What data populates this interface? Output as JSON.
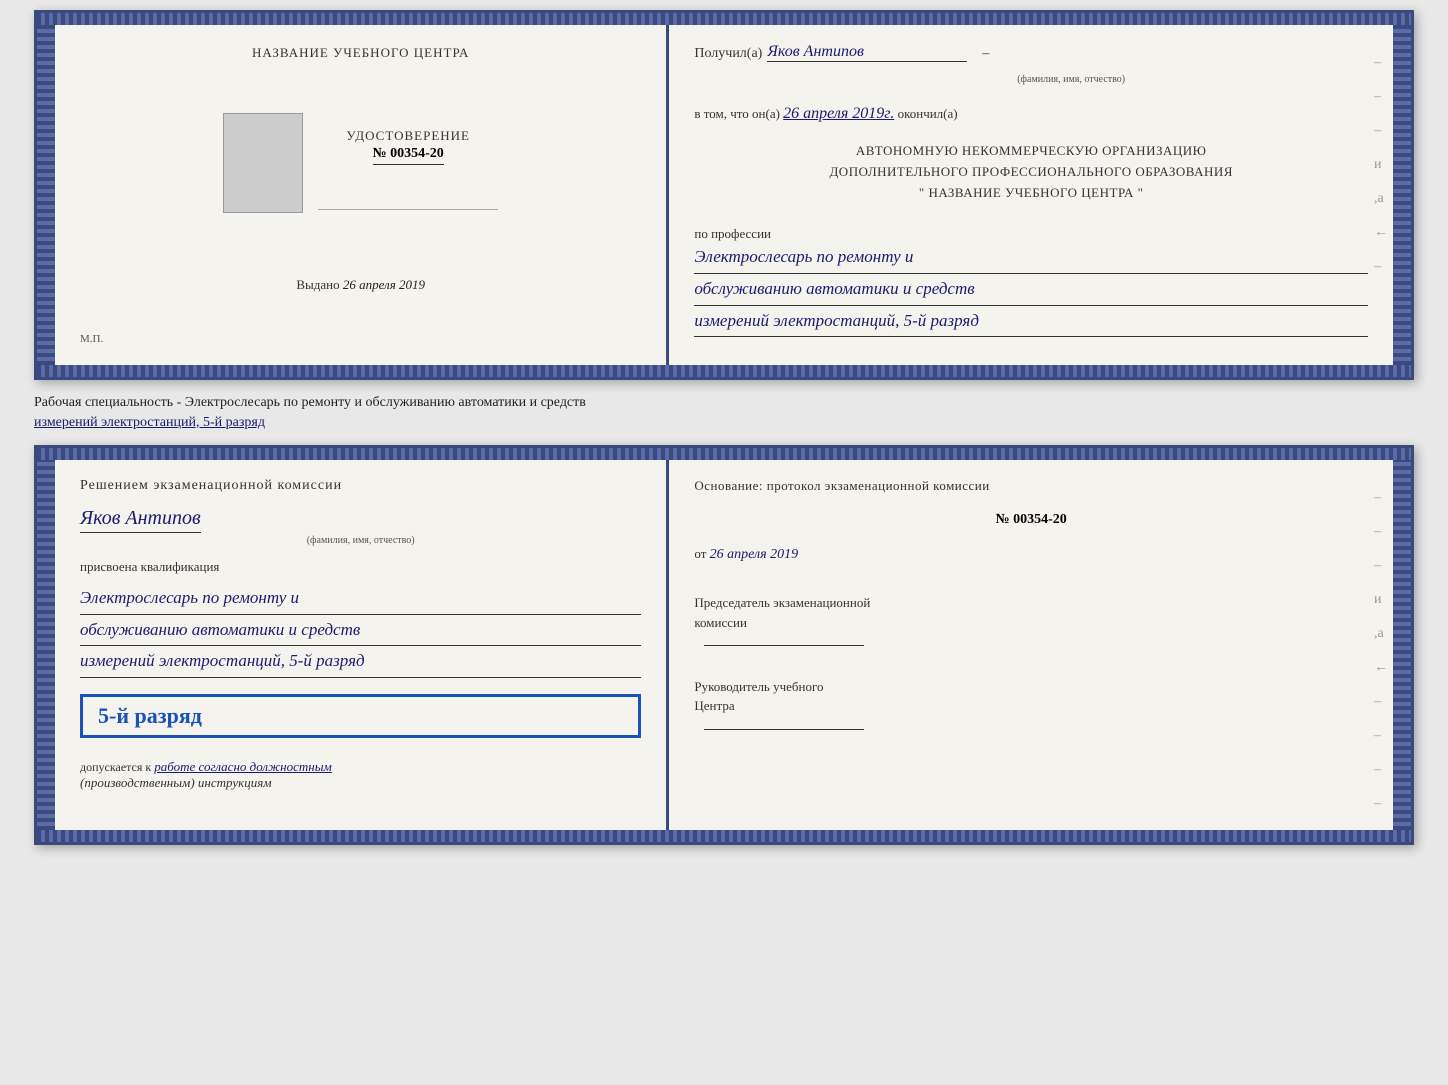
{
  "top_certificate": {
    "left_page": {
      "title": "НАЗВАНИЕ УЧЕБНОГО ЦЕНТРА",
      "cert_label": "УДОСТОВЕРЕНИЕ",
      "cert_no_prefix": "№",
      "cert_no": "00354-20",
      "issued_label": "Выдано",
      "issued_date_handwritten": "26 апреля 2019",
      "stamp_label": "М.П."
    },
    "right_page": {
      "received_label": "Получил(а)",
      "recipient_name": "Яков Антипов",
      "fio_label": "(фамилия, имя, отчество)",
      "date_prefix": "в том, что он(а)",
      "date_handwritten": "26 апреля 2019г.",
      "date_suffix": "окончил(а)",
      "org_line1": "АВТОНОМНУЮ НЕКОММЕРЧЕСКУЮ ОРГАНИЗАЦИЮ",
      "org_line2": "ДОПОЛНИТЕЛЬНОГО ПРОФЕССИОНАЛЬНОГО ОБРАЗОВАНИЯ",
      "org_line3": "\"     НАЗВАНИЕ УЧЕБНОГО ЦЕНТРА     \"",
      "profession_label": "по профессии",
      "profession_line1": "Электрослесарь по ремонту и",
      "profession_line2": "обслуживанию автоматики и средств",
      "profession_line3": "измерений электростанций, 5-й разряд"
    }
  },
  "specialty_text": {
    "prefix": "Рабочая специальность - Электрослесарь по ремонту и обслуживанию автоматики и средств",
    "underlined": "измерений электростанций, 5-й разряд"
  },
  "bottom_certificate": {
    "left_page": {
      "commission_title": "Решением экзаменационной комиссии",
      "person_name": "Яков Антипов",
      "fio_label": "(фамилия, имя, отчество)",
      "qualification_label": "присвоена квалификация",
      "qual_line1": "Электрослесарь по ремонту и",
      "qual_line2": "обслуживанию автоматики и средств",
      "qual_line3": "измерений электростанций, 5-й разряд",
      "rank_badge": "5-й разряд",
      "allowed_prefix": "допускается к",
      "allowed_handwritten": "работе согласно должностным",
      "allowed_line2_italic": "(производственным) инструкциям"
    },
    "right_page": {
      "basis_label": "Основание: протокол экзаменационной  комиссии",
      "protocol_no_prefix": "№",
      "protocol_no": "00354-20",
      "protocol_date_prefix": "от",
      "protocol_date": "26 апреля 2019",
      "chairman_label": "Председатель экзаменационной",
      "chairman_label2": "комиссии",
      "head_label": "Руководитель учебного",
      "head_label2": "Центра"
    }
  }
}
